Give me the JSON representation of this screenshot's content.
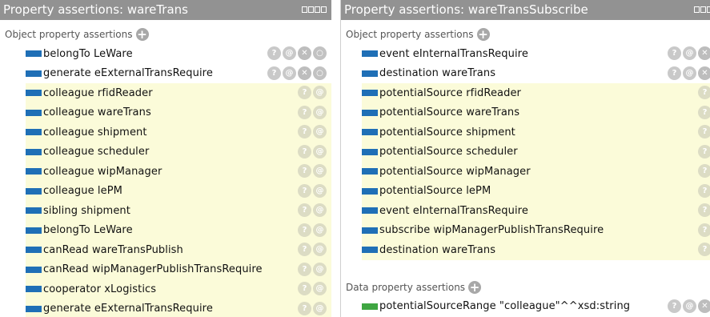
{
  "left": {
    "title": "Property assertions: wareTrans",
    "section_label": "Object property assertions",
    "rows": [
      {
        "text": "belongTo  LeWare",
        "inferred": false
      },
      {
        "text": "generate  eExternalTransRequire",
        "inferred": false
      },
      {
        "text": "colleague  rfidReader",
        "inferred": true
      },
      {
        "text": "colleague  wareTrans",
        "inferred": true
      },
      {
        "text": "colleague  shipment",
        "inferred": true
      },
      {
        "text": "colleague  scheduler",
        "inferred": true
      },
      {
        "text": "colleague  wipManager",
        "inferred": true
      },
      {
        "text": "colleague  lePM",
        "inferred": true
      },
      {
        "text": "sibling  shipment",
        "inferred": true
      },
      {
        "text": "belongTo  LeWare",
        "inferred": true
      },
      {
        "text": "canRead  wareTransPublish",
        "inferred": true
      },
      {
        "text": "canRead  wipManagerPublishTransRequire",
        "inferred": true
      },
      {
        "text": "cooperator  xLogistics",
        "inferred": true
      },
      {
        "text": "generate  eExternalTransRequire",
        "inferred": true
      }
    ]
  },
  "right": {
    "title": "Property assertions: wareTransSubscribe",
    "section_label": "Object property assertions",
    "rows": [
      {
        "text": "event  eInternalTransRequire",
        "inferred": false
      },
      {
        "text": "destination  wareTrans",
        "inferred": false
      },
      {
        "text": "potentialSource  rfidReader",
        "inferred": true
      },
      {
        "text": "potentialSource  wareTrans",
        "inferred": true
      },
      {
        "text": "potentialSource  shipment",
        "inferred": true
      },
      {
        "text": "potentialSource  scheduler",
        "inferred": true
      },
      {
        "text": "potentialSource  wipManager",
        "inferred": true
      },
      {
        "text": "potentialSource  lePM",
        "inferred": true
      },
      {
        "text": "event  eInternalTransRequire",
        "inferred": true
      },
      {
        "text": "subscribe  wipManagerPublishTransRequire",
        "inferred": true
      },
      {
        "text": "destination  wareTrans",
        "inferred": true
      }
    ],
    "data_section_label": "Data property assertions",
    "data_rows": [
      {
        "text": "potentialSourceRange  \"colleague\"^^xsd:string",
        "inferred": false
      }
    ]
  },
  "icons": {
    "add": "+",
    "explain": "?",
    "annotate": "@",
    "delete": "✕",
    "edit": "○"
  },
  "colors": {
    "titlebar": "#929292",
    "inferred_bg": "#fbfbd9",
    "object_property": "#1f6fb6",
    "data_property": "#3fa642"
  }
}
